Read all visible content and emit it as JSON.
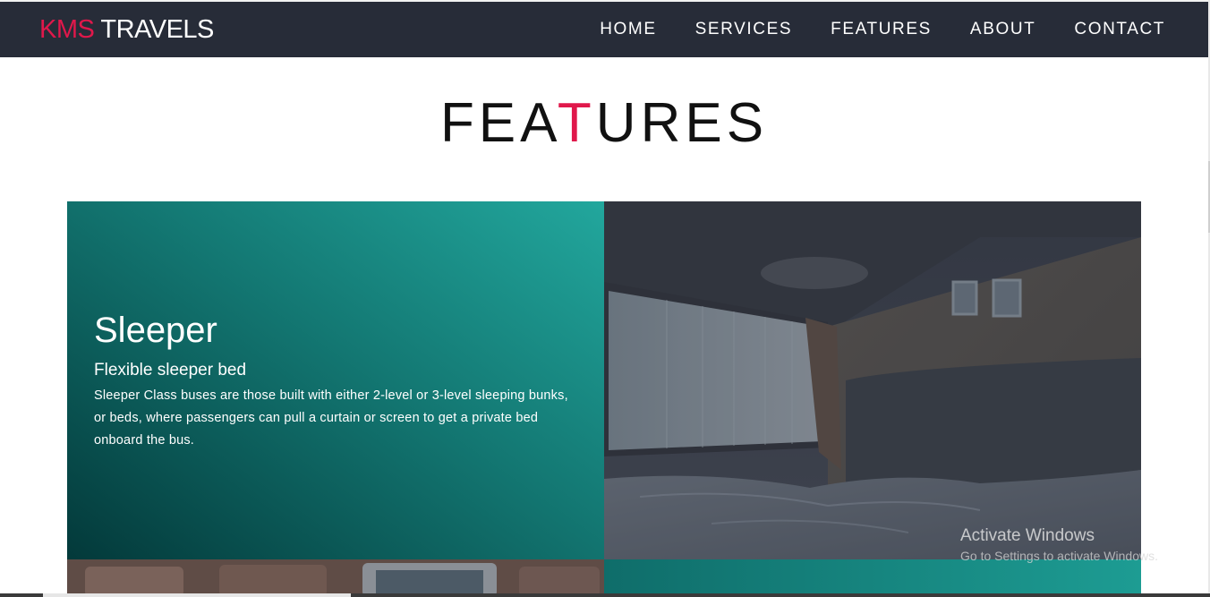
{
  "navbar": {
    "brand_part1": "KMS",
    "brand_part2": "TRAVELS",
    "links": [
      "HOME",
      "SERVICES",
      "FEATURES",
      "ABOUT",
      "CONTACT"
    ]
  },
  "section": {
    "title_before": "FEA",
    "title_accent": "T",
    "title_after": "URES"
  },
  "feature": {
    "title": "Sleeper",
    "subtitle": "Flexible sleeper bed",
    "description": "Sleeper Class buses are those built with either 2-level or 3-level sleeping bunks, or beds, where passengers can pull a curtain or screen to get a private bed onboard the bus."
  },
  "watermark": {
    "title": "Activate Windows",
    "subtitle": "Go to Settings to activate Windows."
  },
  "colors": {
    "navbar_bg": "#272c38",
    "accent": "#e0184b",
    "teal_light": "#22a79d",
    "teal_dark": "#03393a"
  },
  "icons": {
    "bus_interior_image": "sleeper-bus-interior-photo",
    "second_row_image": "bus-seats-photo"
  }
}
